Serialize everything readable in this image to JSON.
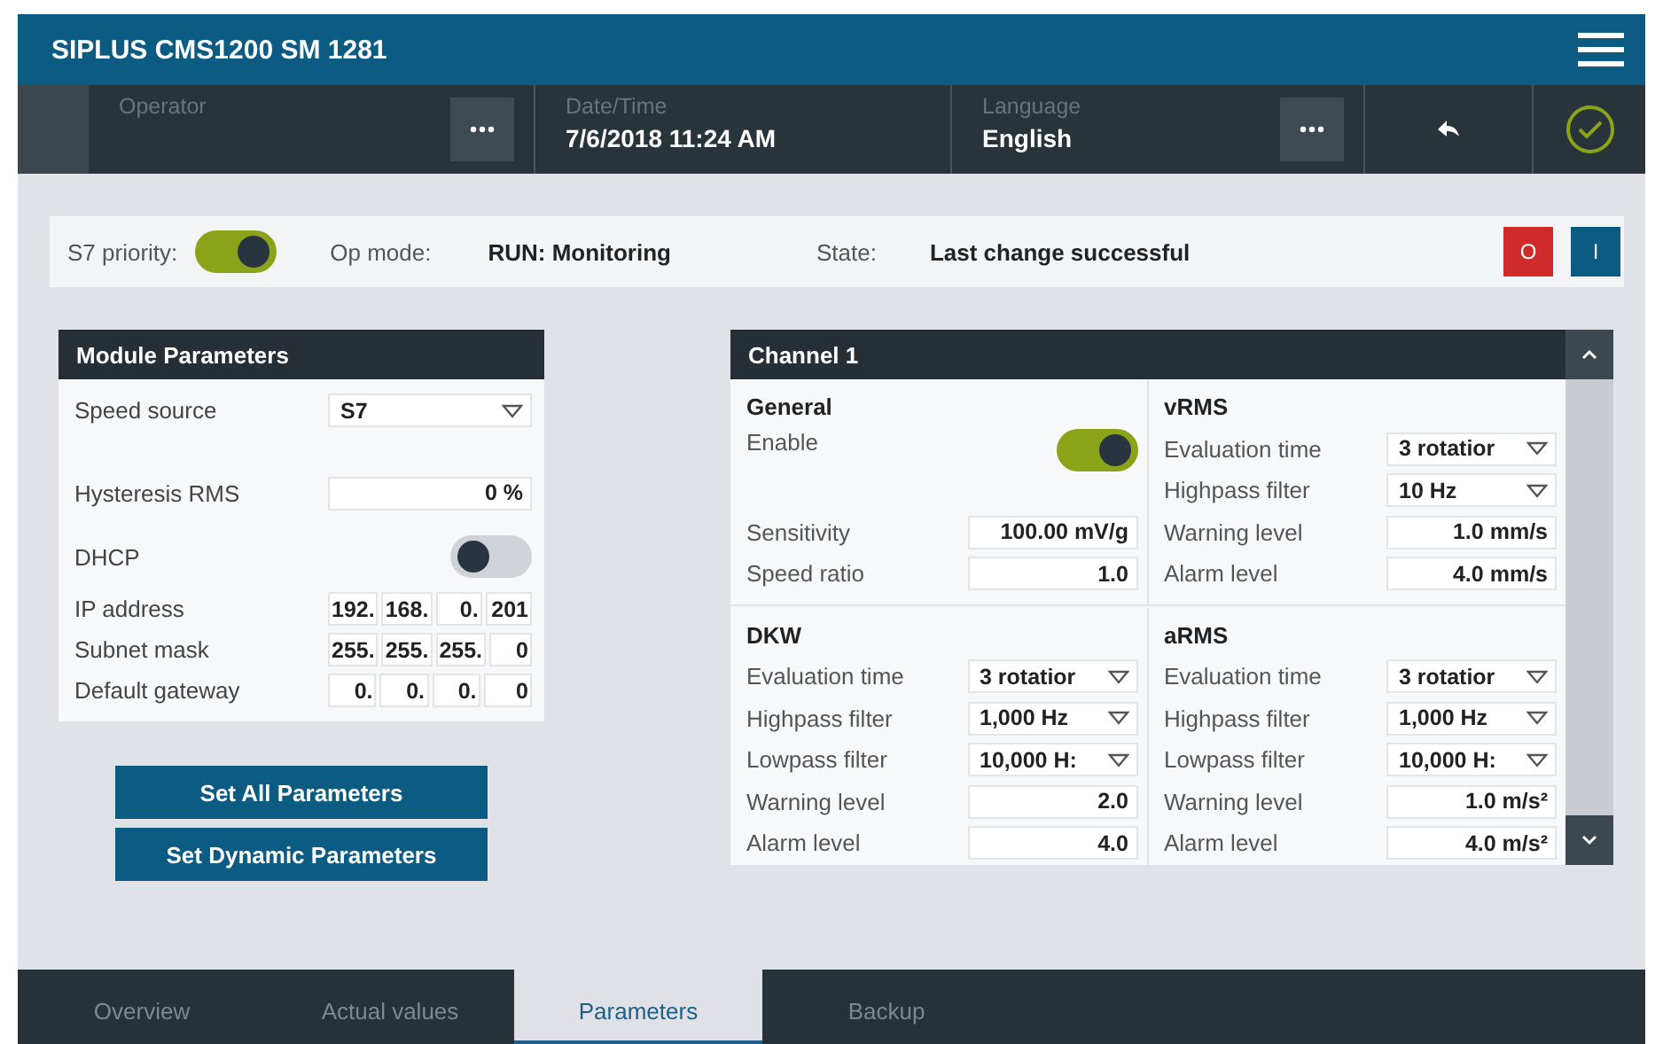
{
  "header": {
    "title": "SIPLUS CMS1200 SM 1281"
  },
  "toolbar": {
    "operator": {
      "label": "Operator"
    },
    "datetime": {
      "label": "Date/Time",
      "value": "7/6/2018 11:24 AM"
    },
    "language": {
      "label": "Language",
      "value": "English"
    }
  },
  "status": {
    "s7_priority": {
      "label": "S7 priority:",
      "on": true
    },
    "op_mode": {
      "label": "Op mode:",
      "value": "RUN: Monitoring"
    },
    "state": {
      "label": "State:",
      "value": "Last change successful"
    },
    "buttons": [
      {
        "label": "O",
        "kind": "stop"
      },
      {
        "label": "I",
        "kind": "start"
      }
    ]
  },
  "module": {
    "title": "Module Parameters",
    "rows": [
      {
        "kind": "select",
        "label": "Speed source",
        "value": "S7"
      },
      {
        "kind": "field",
        "label": "Hysteresis RMS",
        "value": "0 %"
      },
      {
        "kind": "toggle",
        "label": "DHCP",
        "on": false
      },
      {
        "kind": "ip",
        "label": "IP address",
        "octets": [
          "192.",
          "168.",
          "0.",
          "201"
        ]
      },
      {
        "kind": "ip",
        "label": "Subnet mask",
        "octets": [
          "255.",
          "255.",
          "255.",
          "0"
        ]
      },
      {
        "kind": "ip",
        "label": "Default gateway",
        "octets": [
          "0.",
          "0.",
          "0.",
          "0"
        ]
      }
    ]
  },
  "actions": [
    "Set All Parameters",
    "Set Dynamic Parameters"
  ],
  "channel": {
    "title": "Channel 1",
    "sections": [
      {
        "title": "General",
        "rows": [
          {
            "kind": "toggle",
            "label": "Enable",
            "on": true
          },
          {
            "kind": "field",
            "label": "Sensitivity",
            "value": "100.00 mV/g"
          },
          {
            "kind": "field",
            "label": "Speed ratio",
            "value": "1.0"
          }
        ]
      },
      {
        "title": "vRMS",
        "rows": [
          {
            "kind": "select",
            "label": "Evaluation time",
            "value": "3 rotatior"
          },
          {
            "kind": "select",
            "label": "Highpass filter",
            "value": "10 Hz"
          },
          {
            "kind": "field",
            "label": "Warning level",
            "value": "1.0 mm/s"
          },
          {
            "kind": "field",
            "label": "Alarm level",
            "value": "4.0 mm/s"
          }
        ]
      },
      {
        "title": "DKW",
        "rows": [
          {
            "kind": "select",
            "label": "Evaluation time",
            "value": "3 rotatior"
          },
          {
            "kind": "select",
            "label": "Highpass filter",
            "value": "1,000 Hz"
          },
          {
            "kind": "select",
            "label": "Lowpass filter",
            "value": "10,000 H:"
          },
          {
            "kind": "field",
            "label": "Warning level",
            "value": "2.0"
          },
          {
            "kind": "field",
            "label": "Alarm level",
            "value": "4.0"
          }
        ]
      },
      {
        "title": "aRMS",
        "rows": [
          {
            "kind": "select",
            "label": "Evaluation time",
            "value": "3 rotatior"
          },
          {
            "kind": "select",
            "label": "Highpass filter",
            "value": "1,000 Hz"
          },
          {
            "kind": "select",
            "label": "Lowpass filter",
            "value": "10,000 H:"
          },
          {
            "kind": "field",
            "label": "Warning level",
            "value": "1.0 m/s²"
          },
          {
            "kind": "field",
            "label": "Alarm level",
            "value": "4.0 m/s²"
          }
        ]
      }
    ]
  },
  "tabs": [
    {
      "label": "Overview",
      "selected": false
    },
    {
      "label": "Actual values",
      "selected": false
    },
    {
      "label": "Parameters",
      "selected": true
    },
    {
      "label": "Backup",
      "selected": false
    }
  ]
}
